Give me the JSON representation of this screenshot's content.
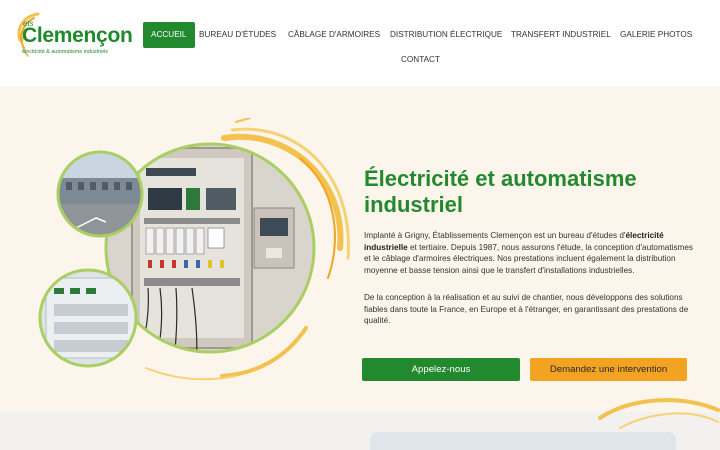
{
  "brand": {
    "prefix": "ets",
    "name": "Clemençon",
    "tagline": "électricité & automatisme industriels",
    "colors": {
      "green": "#23892e",
      "orange": "#f3a322",
      "yellow": "#f2c14e"
    }
  },
  "nav": {
    "items": [
      {
        "label": "ACCUEIL",
        "active": true
      },
      {
        "label": "BUREAU D'ÉTUDES",
        "active": false
      },
      {
        "label": "CÂBLAGE D'ARMOIRES",
        "active": false
      },
      {
        "label": "DISTRIBUTION ÉLECTRIQUE",
        "active": false
      },
      {
        "label": "TRANSFERT INDUSTRIEL",
        "active": false
      },
      {
        "label": "GALERIE PHOTOS",
        "active": false
      },
      {
        "label": "CONTACT",
        "active": false
      }
    ]
  },
  "hero": {
    "title": "Électricité et automatisme industriel",
    "p1_before": "Implanté à Grigny, Établissements Clemençon est un bureau d'études d'",
    "p1_bold": "électricité industrielle",
    "p1_after": " et tertiaire. Depuis 1987, nous assurons l'étude, la conception d'automatismes et le câblage d'armoires électriques. Nos prestations incluent également la distribution moyenne et basse tension ainsi que le transfert d'installations industrielles.",
    "p2": "De la conception à la réalisation et au suivi de chantier, nous développons des solutions fiables dans toute la France, en Europe et à l'étranger, en garantissant des prestations de qualité.",
    "cta_call": "Appelez-nous",
    "cta_request": "Demandez une intervention"
  }
}
